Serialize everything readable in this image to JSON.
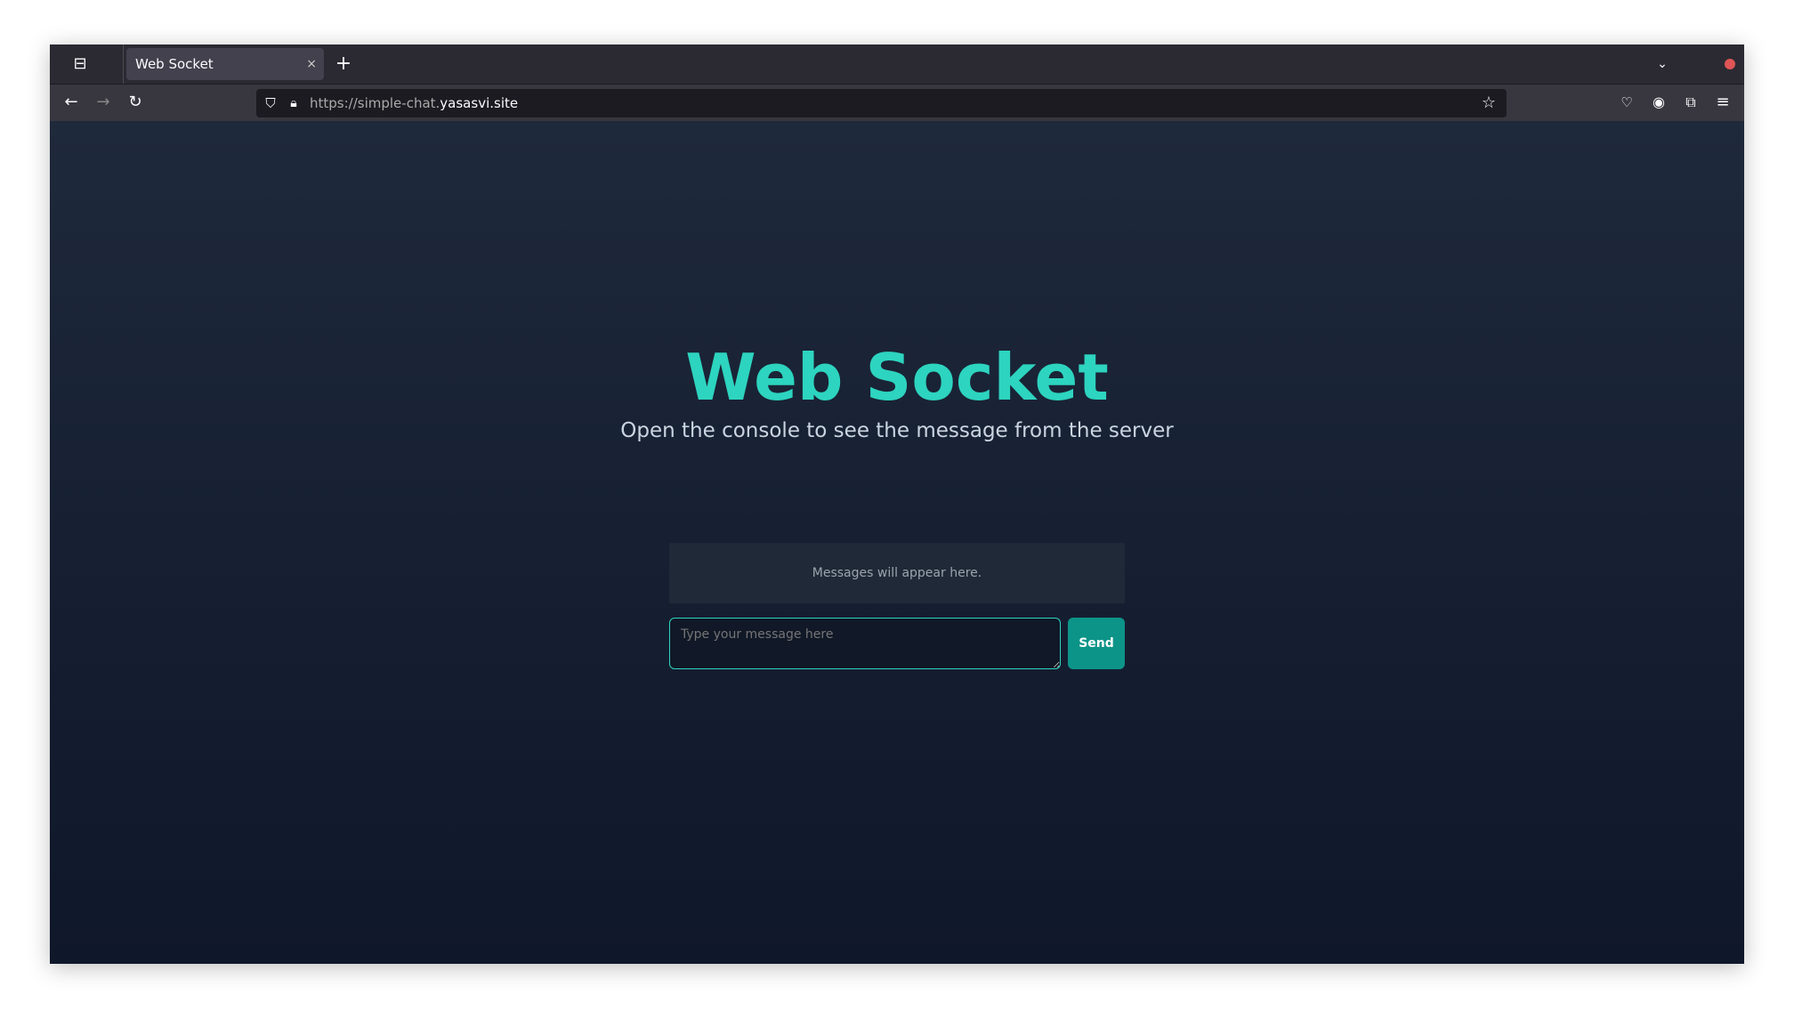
{
  "browser": {
    "tab_title": "Web Socket",
    "url_prefix": "https://simple-chat.",
    "url_domain": "yasasvi.site",
    "icons": [
      "tab-list-icon",
      "close-icon",
      "new-tab-icon",
      "chevron-down-icon",
      "back-icon",
      "forward-icon",
      "reload-icon",
      "shield-icon",
      "lock-icon",
      "bookmark-star-icon",
      "pocket-icon",
      "account-icon",
      "extensions-icon",
      "menu-icon"
    ],
    "close_glyph": "×",
    "new_tab_glyph": "+"
  },
  "page": {
    "title": "Web Socket",
    "subtitle": "Open the console to see the message from the server",
    "messages_placeholder": "Messages will appear here.",
    "input_placeholder": "Type your message here",
    "send_label": "Send"
  },
  "colors": {
    "accent": "#2dd4bf",
    "button": "#0d9488",
    "bg_top": "#1e293b",
    "bg_bottom": "#0f172a"
  }
}
